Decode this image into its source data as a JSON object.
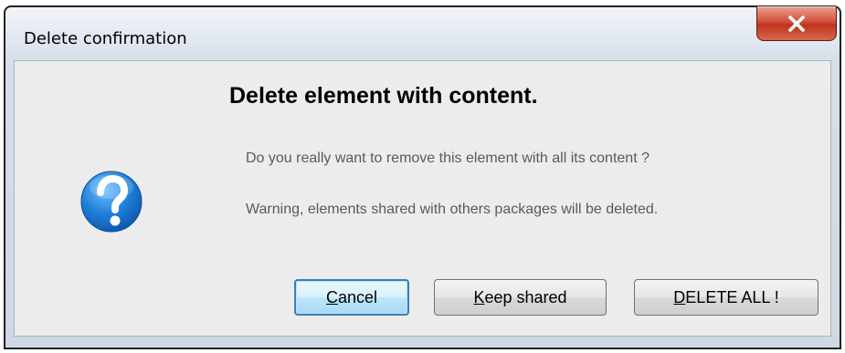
{
  "window": {
    "title": "Delete confirmation",
    "close_icon": "close-x-icon"
  },
  "dialog": {
    "icon": "question-mark-icon",
    "heading": "Delete element with content.",
    "message1": "Do you really want to remove this element with all its content ?",
    "message2": "Warning, elements shared with others packages will be deleted."
  },
  "buttons": {
    "cancel": {
      "mnemonic": "C",
      "rest": "ancel"
    },
    "keep": {
      "mnemonic": "K",
      "rest": "eep shared"
    },
    "delete": {
      "mnemonic": "D",
      "rest": "ELETE ALL !"
    }
  },
  "colors": {
    "close_button": "#c7412a",
    "icon_blue": "#1f7fd8",
    "default_button_border": "#3c7fb1"
  }
}
